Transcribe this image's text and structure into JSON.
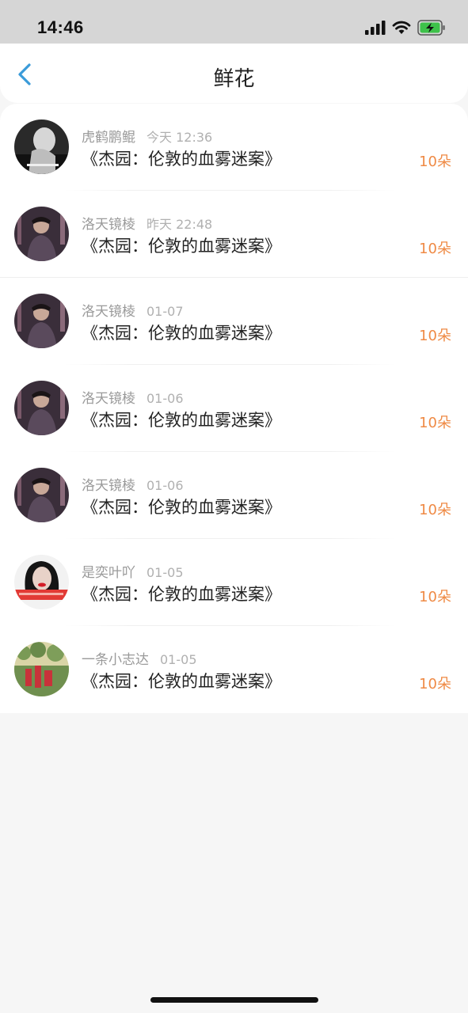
{
  "status_bar": {
    "time": "14:46"
  },
  "header": {
    "title": "鲜花"
  },
  "items": [
    {
      "user": "虎鹤鹏鲲",
      "time": "今天 12:36",
      "book": "《杰园：伦敦的血雾迷案》",
      "count": "10朵"
    },
    {
      "user": "洛天镜棱",
      "time": "昨天 22:48",
      "book": "《杰园：伦敦的血雾迷案》",
      "count": "10朵"
    },
    {
      "user": "洛天镜棱",
      "time": "01-07",
      "book": "《杰园：伦敦的血雾迷案》",
      "count": "10朵"
    },
    {
      "user": "洛天镜棱",
      "time": "01-06",
      "book": "《杰园：伦敦的血雾迷案》",
      "count": "10朵"
    },
    {
      "user": "洛天镜棱",
      "time": "01-06",
      "book": "《杰园：伦敦的血雾迷案》",
      "count": "10朵"
    },
    {
      "user": "是奕叶吖",
      "time": "01-05",
      "book": "《杰园：伦敦的血雾迷案》",
      "count": "10朵"
    },
    {
      "user": "一条小志达",
      "time": "01-05",
      "book": "《杰园：伦敦的血雾迷案》",
      "count": "10朵"
    }
  ],
  "colors": {
    "accent": "#ef8a45",
    "back_arrow": "#3a9bd9"
  },
  "icons": [
    "signal-icon",
    "wifi-icon",
    "battery-charging-icon",
    "back-arrow-icon"
  ]
}
